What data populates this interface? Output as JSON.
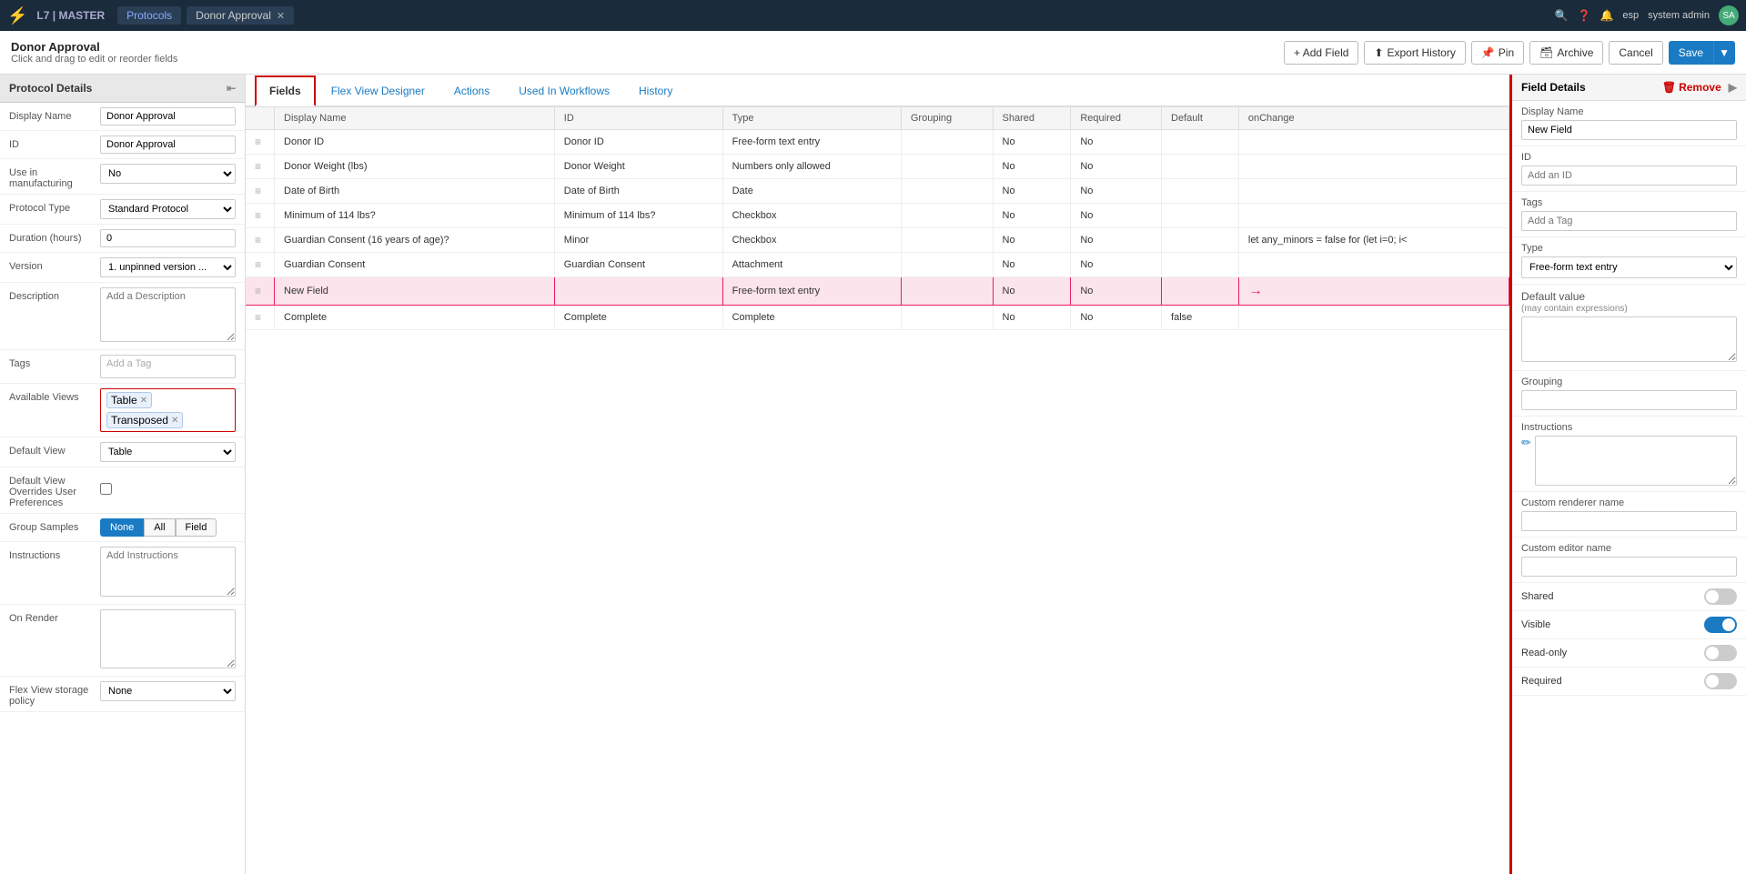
{
  "topNav": {
    "logo": "⚡",
    "appName": "L7 | MASTER",
    "tabs": [
      {
        "label": "Protocols",
        "active": false
      },
      {
        "label": "Donor Approval",
        "active": true
      }
    ],
    "icons": [
      "🔍",
      "❓",
      "🔔"
    ],
    "userRegion": "esp",
    "userName": "system admin"
  },
  "subHeader": {
    "title": "Donor Approval",
    "subtitle": "Click and drag to edit or reorder fields",
    "buttons": [
      {
        "label": "+ Add Field",
        "type": "secondary"
      },
      {
        "label": "Export History",
        "type": "secondary"
      },
      {
        "label": "Pin",
        "type": "secondary"
      },
      {
        "label": "Archive",
        "type": "secondary"
      },
      {
        "label": "Cancel",
        "type": "secondary"
      },
      {
        "label": "Save",
        "type": "primary"
      }
    ]
  },
  "leftPanel": {
    "title": "Protocol Details",
    "fields": {
      "displayName": "Donor Approval",
      "id": "Donor Approval",
      "useInManufacturing": "No",
      "protocolType": "Standard Protocol",
      "durationHours": "0",
      "version": "1. unpinned version ...",
      "descriptionPlaceholder": "Add a Description",
      "tagsPlaceholder": "Add a Tag",
      "availableViews": [
        "Table",
        "Transposed"
      ],
      "defaultView": "Table",
      "defaultViewOverrides": false,
      "groupSamples": [
        "None",
        "All",
        "Field"
      ],
      "groupSamplesActive": "None",
      "instructionsPlaceholder": "Add Instructions",
      "flexViewStoragePolicy": "None"
    }
  },
  "tabs": [
    {
      "label": "Fields",
      "active": true
    },
    {
      "label": "Flex View Designer",
      "active": false
    },
    {
      "label": "Actions",
      "active": false
    },
    {
      "label": "Used In Workflows",
      "active": false
    },
    {
      "label": "History",
      "active": false
    }
  ],
  "table": {
    "columns": [
      "Display Name",
      "ID",
      "Type",
      "Grouping",
      "Shared",
      "Required",
      "Default",
      "onChange"
    ],
    "rows": [
      {
        "displayName": "Donor ID",
        "id": "Donor ID",
        "type": "Free-form text entry",
        "grouping": "",
        "shared": "No",
        "required": "No",
        "default": "",
        "onChange": ""
      },
      {
        "displayName": "Donor Weight (lbs)",
        "id": "Donor Weight",
        "type": "Numbers only allowed",
        "grouping": "",
        "shared": "No",
        "required": "No",
        "default": "",
        "onChange": ""
      },
      {
        "displayName": "Date of Birth",
        "id": "Date of Birth",
        "type": "Date",
        "grouping": "",
        "shared": "No",
        "required": "No",
        "default": "",
        "onChange": ""
      },
      {
        "displayName": "Minimum of 114 lbs?",
        "id": "Minimum of 114 lbs?",
        "type": "Checkbox",
        "grouping": "",
        "shared": "No",
        "required": "No",
        "default": "",
        "onChange": ""
      },
      {
        "displayName": "Guardian Consent (16 years of age)?",
        "id": "Minor",
        "type": "Checkbox",
        "grouping": "",
        "shared": "No",
        "required": "No",
        "default": "",
        "onChange": "let any_minors = false for (let i=0; i<"
      },
      {
        "displayName": "Guardian Consent",
        "id": "Guardian Consent",
        "type": "Attachment",
        "grouping": "",
        "shared": "No",
        "required": "No",
        "default": "",
        "onChange": ""
      },
      {
        "displayName": "New Field",
        "id": "",
        "type": "Free-form text entry",
        "grouping": "",
        "shared": "No",
        "required": "No",
        "default": "",
        "onChange": "",
        "selected": true
      },
      {
        "displayName": "Complete",
        "id": "Complete",
        "type": "Complete",
        "grouping": "",
        "shared": "No",
        "required": "No",
        "default": "false",
        "onChange": ""
      }
    ]
  },
  "rightPanel": {
    "title": "Field Details",
    "removeLabel": "Remove",
    "fields": {
      "displayName": "New Field",
      "displayNamePlaceholder": "New Field",
      "idPlaceholder": "Add an ID",
      "tagsPlaceholder": "Add a Tag",
      "type": "Free-form text entry",
      "defaultValueLabel": "Default value",
      "defaultValueSublabel": "(may contain expressions)",
      "groupingPlaceholder": "",
      "instructionsLabel": "Instructions",
      "customRendererLabel": "Custom renderer name",
      "customEditorLabel": "Custom editor name",
      "shared": false,
      "visible": true,
      "readOnly": false,
      "required": false
    }
  }
}
